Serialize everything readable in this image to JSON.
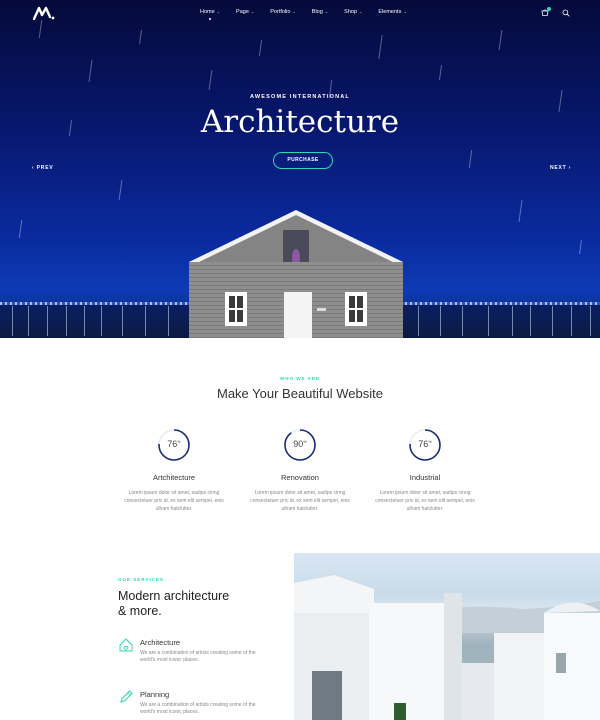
{
  "nav": {
    "items": [
      {
        "label": "Home",
        "caret": "⌄"
      },
      {
        "label": "Page",
        "caret": "⌄"
      },
      {
        "label": "Portfolio",
        "caret": "⌄"
      },
      {
        "label": "Blog",
        "caret": "⌄"
      },
      {
        "label": "Shop",
        "caret": "⌄"
      },
      {
        "label": "Elements",
        "caret": "⌄"
      }
    ]
  },
  "hero": {
    "eyebrow": "AWESOME INTERNATIONAL",
    "title": "Architecture",
    "button": "PURCHASE",
    "prev": "‹  PREV",
    "next": "NEXT  ›"
  },
  "who": {
    "eyebrow": "WHO WE ARE",
    "title": "Make Your Beautiful Website",
    "features": [
      {
        "value": "76",
        "unit": "%",
        "percent": 76,
        "name": "Artchitecture",
        "text": "Lorem ipsum dolor sit amet, sadips cinng consectetuer pric id, ex sem elit sempel, enis ulham hatclutter."
      },
      {
        "value": "90",
        "unit": "%",
        "percent": 90,
        "name": "Renovation",
        "text": "Lorem ipsum dolor sit amet, sadips cinng consectetuer pric id, ex sem elit sempel, enis ulham hatclutter."
      },
      {
        "value": "76",
        "unit": "%",
        "percent": 76,
        "name": "Industrial",
        "text": "Lorem ipsum dolor sit amet, sadips cinng consectetuer pric id, ex sem elit sempel, enis ulham hatclutter."
      }
    ]
  },
  "services": {
    "eyebrow": "OUR SERVICES",
    "title_line1": "Modern architecture",
    "title_line2": "& more.",
    "items": [
      {
        "icon": "house-icon",
        "name": "Architecture",
        "desc": "We are a combination of artists creating some of the world's most iconic places."
      },
      {
        "icon": "pencil-icon",
        "name": "Planning",
        "desc": "We are a combination of artists creating some of the world's most iconic places."
      }
    ]
  },
  "colors": {
    "accent": "#2bd8b2",
    "ring": "#1d2b7a",
    "hero_sky": "#07166a"
  }
}
